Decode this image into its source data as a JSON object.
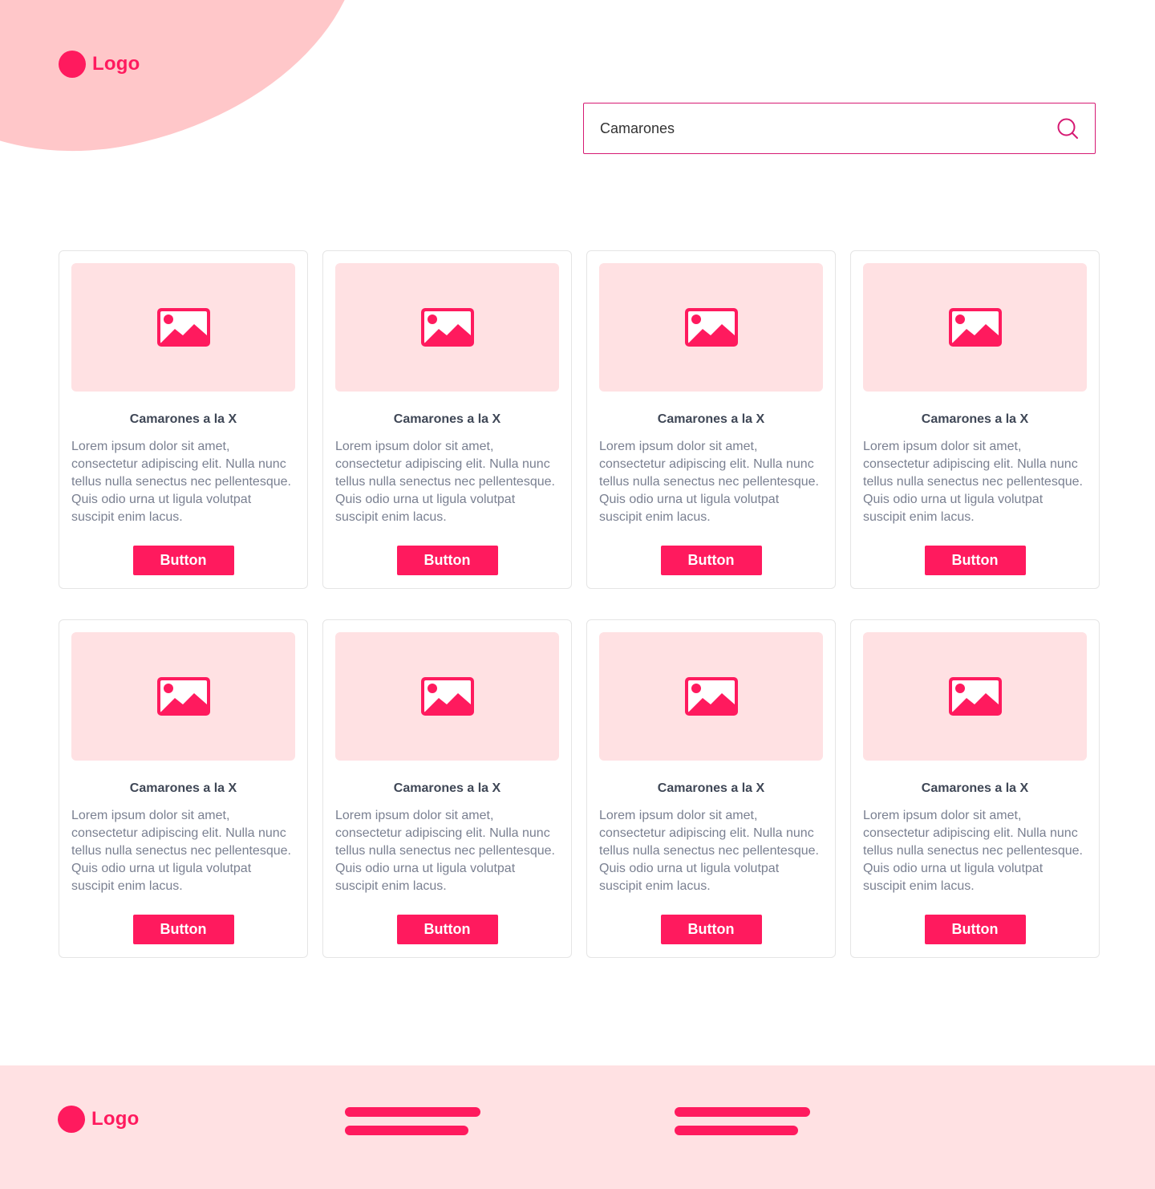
{
  "colors": {
    "brand": "#FF1A5E",
    "blob": "#FFC7C9",
    "placeholder_bg": "#FFE1E3",
    "search_border": "#D61A73"
  },
  "header": {
    "logo_label": "Logo"
  },
  "search": {
    "value": "Camarones",
    "icon": "search-icon"
  },
  "cards": [
    {
      "title": "Camarones a la X",
      "description": "Lorem ipsum dolor sit amet, consectetur adipiscing elit. Nulla nunc tellus nulla senectus nec pellentesque. Quis odio urna ut ligula volutpat suscipit enim lacus.",
      "button": "Button",
      "image_icon": "image-icon"
    },
    {
      "title": "Camarones a la X",
      "description": "Lorem ipsum dolor sit amet, consectetur adipiscing elit. Nulla nunc tellus nulla senectus nec pellentesque. Quis odio urna ut ligula volutpat suscipit enim lacus.",
      "button": "Button",
      "image_icon": "image-icon"
    },
    {
      "title": "Camarones a la X",
      "description": "Lorem ipsum dolor sit amet, consectetur adipiscing elit. Nulla nunc tellus nulla senectus nec pellentesque. Quis odio urna ut ligula volutpat suscipit enim lacus.",
      "button": "Button",
      "image_icon": "image-icon"
    },
    {
      "title": "Camarones a la X",
      "description": "Lorem ipsum dolor sit amet, consectetur adipiscing elit. Nulla nunc tellus nulla senectus nec pellentesque. Quis odio urna ut ligula volutpat suscipit enim lacus.",
      "button": "Button",
      "image_icon": "image-icon"
    },
    {
      "title": "Camarones a la X",
      "description": "Lorem ipsum dolor sit amet, consectetur adipiscing elit. Nulla nunc tellus nulla senectus nec pellentesque. Quis odio urna ut ligula volutpat suscipit enim lacus.",
      "button": "Button",
      "image_icon": "image-icon"
    },
    {
      "title": "Camarones a la X",
      "description": "Lorem ipsum dolor sit amet, consectetur adipiscing elit. Nulla nunc tellus nulla senectus nec pellentesque. Quis odio urna ut ligula volutpat suscipit enim lacus.",
      "button": "Button",
      "image_icon": "image-icon"
    },
    {
      "title": "Camarones a la X",
      "description": "Lorem ipsum dolor sit amet, consectetur adipiscing elit. Nulla nunc tellus nulla senectus nec pellentesque. Quis odio urna ut ligula volutpat suscipit enim lacus.",
      "button": "Button",
      "image_icon": "image-icon"
    },
    {
      "title": "Camarones a la X",
      "description": "Lorem ipsum dolor sit amet, consectetur adipiscing elit. Nulla nunc tellus nulla senectus nec pellentesque. Quis odio urna ut ligula volutpat suscipit enim lacus.",
      "button": "Button",
      "image_icon": "image-icon"
    }
  ],
  "footer": {
    "logo_label": "Logo"
  }
}
